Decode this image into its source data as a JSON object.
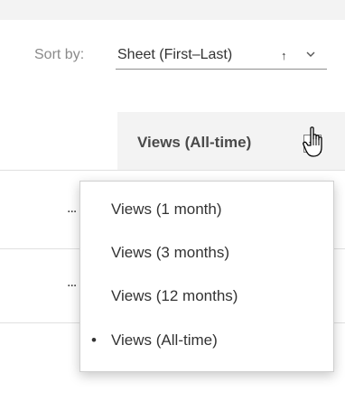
{
  "sort": {
    "label": "Sort by:",
    "value": "Sheet (First–Last)",
    "direction_glyph": "↑",
    "chevron_icon": "chevron-down-icon"
  },
  "column": {
    "header": "Views (All-time)",
    "dropdown_icon": "caret-down-icon"
  },
  "rows": [
    {
      "ellipsis": "..."
    },
    {
      "ellipsis": "..."
    }
  ],
  "menu": {
    "items": [
      {
        "label": "Views (1 month)",
        "selected": false,
        "marker": ""
      },
      {
        "label": "Views (3 months)",
        "selected": false,
        "marker": ""
      },
      {
        "label": "Views (12 months)",
        "selected": false,
        "marker": ""
      },
      {
        "label": "Views (All-time)",
        "selected": true,
        "marker": "•"
      }
    ]
  },
  "cursor": {
    "icon": "hand-pointer-icon"
  }
}
